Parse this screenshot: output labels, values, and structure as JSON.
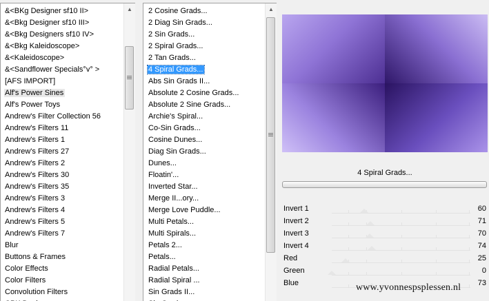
{
  "categories": {
    "items": [
      "&<BKg Designer sf10 II>",
      "&<Bkg Designer sf10 III>",
      "&<Bkg Designers sf10 IV>",
      "&<Bkg Kaleidoscope>",
      "&<Kaleidoscope>",
      "&<Sandflower Specials°v° >",
      "[AFS IMPORT]",
      "Alf's Power Sines",
      "Alf's Power Toys",
      "Andrew's Filter Collection 56",
      "Andrew's Filters 11",
      "Andrew's Filters 1",
      "Andrew's Filters 27",
      "Andrew's Filters 2",
      "Andrew's Filters 30",
      "Andrew's Filters 35",
      "Andrew's Filters 3",
      "Andrew's Filters 4",
      "Andrew's Filters 5",
      "Andrew's Filters 7",
      "Blur",
      "Buttons & Frames",
      "Color Effects",
      "Color Filters",
      "Convolution Filters",
      "CPK Designs"
    ],
    "highlighted": "Alf's Power Sines"
  },
  "filters": {
    "items": [
      "2 Cosine Grads...",
      "2 Diag Sin Grads...",
      "2 Sin Grads...",
      "2 Spiral Grads...",
      "2 Tan Grads...",
      "4 Spiral Grads...",
      "Abs Sin Grads II...",
      "Absolute 2 Cosine Grads...",
      "Absolute 2 Sine Grads...",
      "Archie's Spiral...",
      "Co-Sin Grads...",
      "Cosine Dunes...",
      "Diag Sin Grads...",
      "Dunes...",
      "Floatin'...",
      "Inverted Star...",
      "Merge II...ory...",
      "Merge Love Puddle...",
      "Multi Petals...",
      "Multi Spirals...",
      "Petals 2...",
      "Petals...",
      "Radial Petals...",
      "Radial Spiral ...",
      "Sin Grads II...",
      "Sin Grads..."
    ],
    "selected": "4 Spiral Grads..."
  },
  "preview": {
    "colors": [
      "#b9a6ef",
      "#4d2f93",
      "#cbbcf3",
      "#2f1769"
    ]
  },
  "filter_title": "4 Spiral Grads...",
  "params": [
    {
      "label": "Invert 1",
      "value": 60
    },
    {
      "label": "Invert 2",
      "value": 71
    },
    {
      "label": "Invert 3",
      "value": 70
    },
    {
      "label": "Invert 4",
      "value": 74
    },
    {
      "label": "Red",
      "value": 25
    },
    {
      "label": "Green",
      "value": 0
    },
    {
      "label": "Blue",
      "value": 73
    }
  ],
  "watermark": "www.yvonnespsplessen.nl",
  "icons": {
    "scroll_up": "scroll-up-arrow-icon",
    "scroll_down": "scroll-down-arrow-icon",
    "thumb_grip": "scroll-grip-icon"
  }
}
